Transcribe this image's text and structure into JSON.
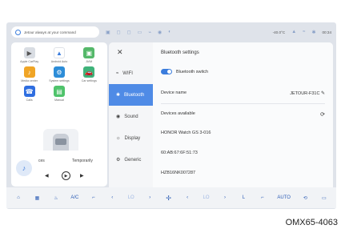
{
  "statusbar": {
    "assistant_text": "Jetour always at your command",
    "temperature": "-40.0°C",
    "time": "00:34"
  },
  "apps": [
    {
      "label": "Apple CarPlay",
      "color": "#d9dde3",
      "glyph": "▶"
    },
    {
      "label": "Android Auto",
      "color": "#ffffff",
      "glyph": "▲"
    },
    {
      "label": "AVM",
      "color": "#55b86a",
      "glyph": "▣"
    },
    {
      "label": "Media center",
      "color": "#f0a526",
      "glyph": "♪"
    },
    {
      "label": "System settings",
      "color": "#2d8dd8",
      "glyph": "⚙"
    },
    {
      "label": "Car settings",
      "color": "#3fb37a",
      "glyph": "🚗"
    },
    {
      "label": "Calls",
      "color": "#2f6ee0",
      "glyph": "☎"
    },
    {
      "label": "Manual",
      "color": "#4fc36b",
      "glyph": "▤"
    }
  ],
  "music": {
    "track_left": "ces",
    "track_right": "Temporarily",
    "prev": "◀",
    "play": "▶",
    "next": "▶"
  },
  "nav": [
    {
      "label": "WIFI",
      "glyph": "≈"
    },
    {
      "label": "Bluetooth",
      "glyph": "✱"
    },
    {
      "label": "Sound",
      "glyph": "◉"
    },
    {
      "label": "Display",
      "glyph": "☼"
    },
    {
      "label": "Generic",
      "glyph": "⚙"
    }
  ],
  "bluetooth": {
    "title": "Bluetooth settings",
    "switch_label": "Bluetooth switch",
    "device_name_label": "Device name",
    "device_name_value": "JETOUR-F31C",
    "available_label": "Devices available",
    "devices": [
      "HONOR Watch GS 3-016",
      "60:AB:67:6F:51:73",
      "HZB16NK007287"
    ]
  },
  "bottom": {
    "ac": "A/C",
    "lo_left": "LO",
    "lo_right": "LO",
    "auto": "AUTO"
  },
  "caption": "OMX65-4063"
}
